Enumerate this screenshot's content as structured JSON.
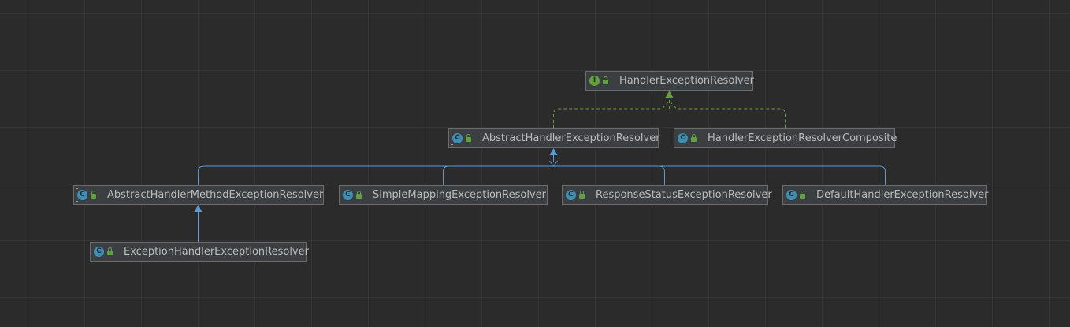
{
  "diagram": {
    "nodes": [
      {
        "id": "handler-exception-resolver",
        "label": "HandlerExceptionResolver",
        "kind": "interface",
        "kind_glyph": "I"
      },
      {
        "id": "abstract-handler-exception-resolver",
        "label": "AbstractHandlerExceptionResolver",
        "kind": "abstract",
        "kind_glyph": "C"
      },
      {
        "id": "handler-exception-resolver-composite",
        "label": "HandlerExceptionResolverComposite",
        "kind": "class",
        "kind_glyph": "C"
      },
      {
        "id": "abstract-handler-method-exception-resolver",
        "label": "AbstractHandlerMethodExceptionResolver",
        "kind": "abstract",
        "kind_glyph": "C"
      },
      {
        "id": "simple-mapping-exception-resolver",
        "label": "SimpleMappingExceptionResolver",
        "kind": "class",
        "kind_glyph": "C"
      },
      {
        "id": "response-status-exception-resolver",
        "label": "ResponseStatusExceptionResolver",
        "kind": "class",
        "kind_glyph": "C"
      },
      {
        "id": "default-handler-exception-resolver",
        "label": "DefaultHandlerExceptionResolver",
        "kind": "class",
        "kind_glyph": "C"
      },
      {
        "id": "exception-handler-exception-resolver",
        "label": "ExceptionHandlerExceptionResolver",
        "kind": "class",
        "kind_glyph": "C"
      }
    ],
    "edges": [
      {
        "from": "abstract-handler-exception-resolver",
        "to": "handler-exception-resolver",
        "relation": "implements"
      },
      {
        "from": "handler-exception-resolver-composite",
        "to": "handler-exception-resolver",
        "relation": "implements"
      },
      {
        "from": "abstract-handler-method-exception-resolver",
        "to": "abstract-handler-exception-resolver",
        "relation": "extends"
      },
      {
        "from": "simple-mapping-exception-resolver",
        "to": "abstract-handler-exception-resolver",
        "relation": "extends"
      },
      {
        "from": "response-status-exception-resolver",
        "to": "abstract-handler-exception-resolver",
        "relation": "extends"
      },
      {
        "from": "default-handler-exception-resolver",
        "to": "abstract-handler-exception-resolver",
        "relation": "extends"
      },
      {
        "from": "exception-handler-exception-resolver",
        "to": "abstract-handler-method-exception-resolver",
        "relation": "extends"
      }
    ],
    "colors": {
      "background": "#2b2b2b",
      "node_fill": "#3c3f41",
      "node_border": "#6b6b6b",
      "label_text": "#bbbbbb",
      "extends_edge": "#5b9bd5",
      "implements_edge": "#62a03d",
      "interface_icon": "#62a03d",
      "class_icon": "#3f8fb5"
    },
    "icons": {
      "interface": "interface-icon",
      "class": "class-icon",
      "abstract": "abstract-class-icon",
      "visibility": "public-lock-icon"
    }
  }
}
